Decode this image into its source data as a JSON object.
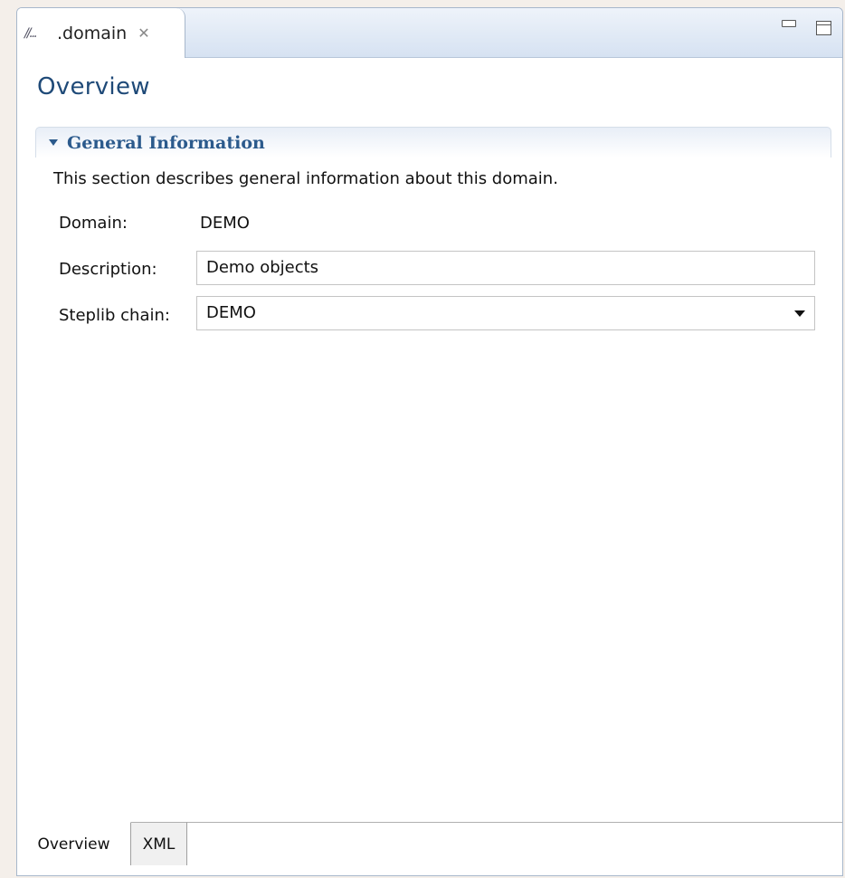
{
  "editor_tab": {
    "label": ".domain",
    "icon": "domain-file-icon",
    "close_icon": "close-icon"
  },
  "window_controls": {
    "minimize": "minimize-icon",
    "maximize": "maximize-icon"
  },
  "page": {
    "title": "Overview"
  },
  "section": {
    "title": "General Information",
    "description": "This section describes general information about this domain."
  },
  "form": {
    "domain_label": "Domain:",
    "domain_value": "DEMO",
    "description_label": "Description:",
    "description_value": "Demo objects",
    "steplib_label": "Steplib chain:",
    "steplib_value": "DEMO"
  },
  "bottom_tabs": [
    {
      "label": "Overview",
      "active": true
    },
    {
      "label": "XML",
      "active": false
    }
  ],
  "colors": {
    "title": "#1f4a78",
    "section_title": "#2b5a8c",
    "frame": "#a7b7cb"
  }
}
